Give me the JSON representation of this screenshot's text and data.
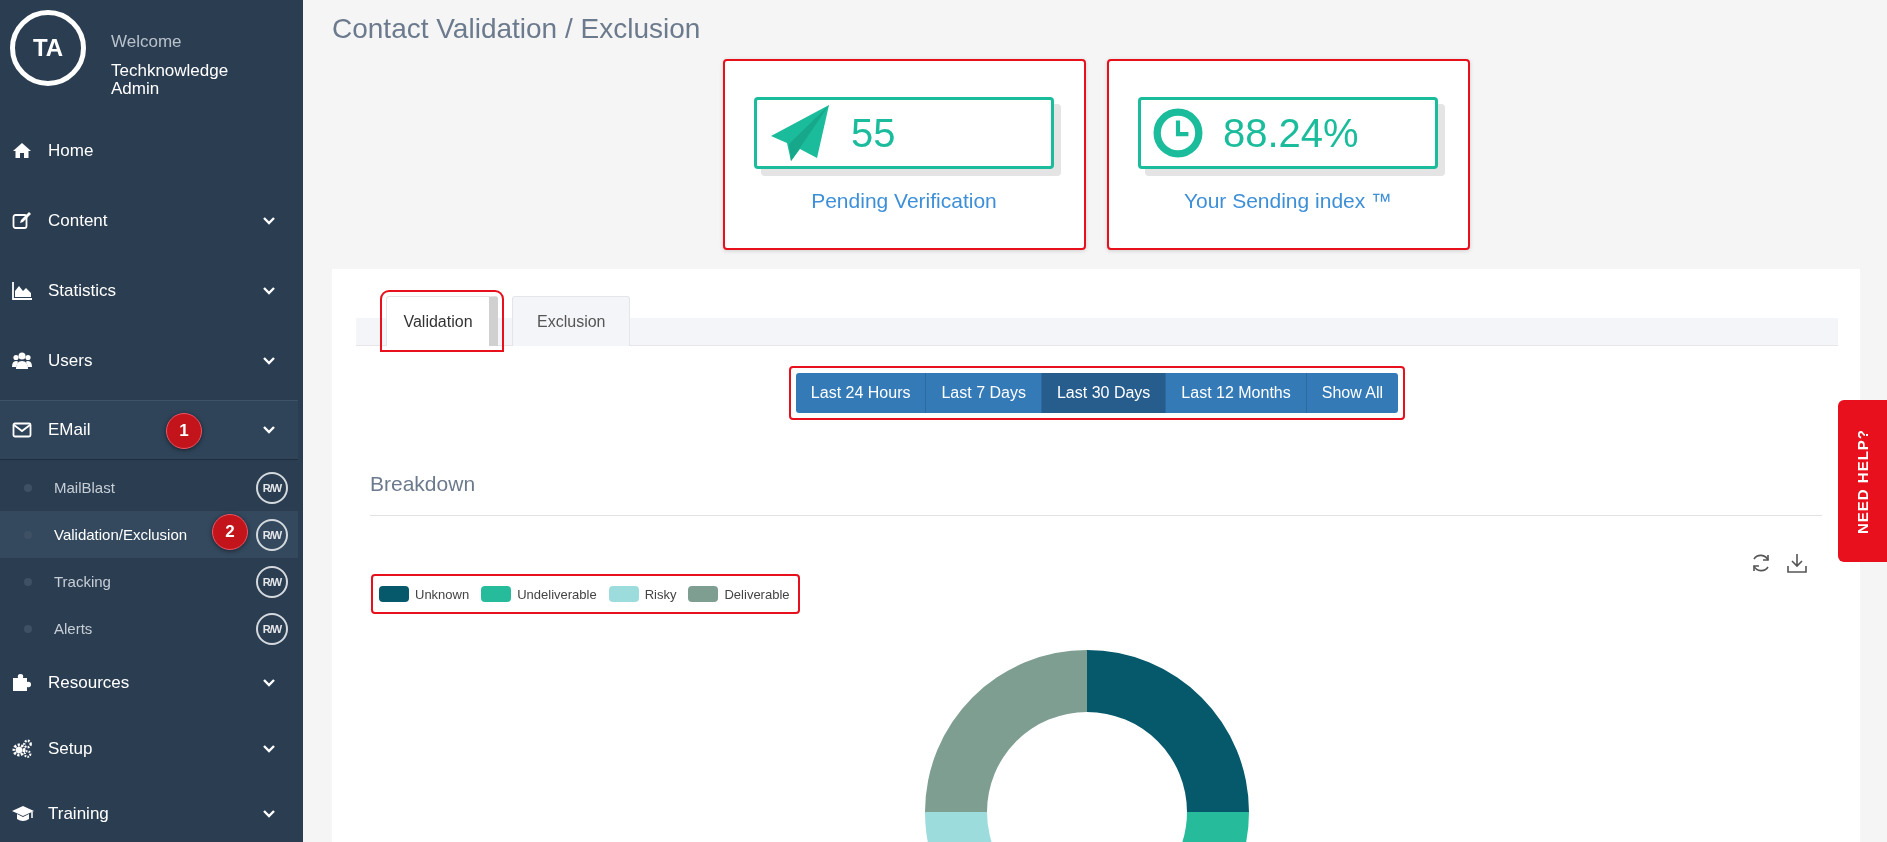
{
  "user": {
    "initials": "TA",
    "greeting": "Welcome",
    "name": "Techknowledge Admin"
  },
  "sidebar": {
    "items": [
      {
        "label": "Home",
        "kind": "link"
      },
      {
        "label": "Content",
        "kind": "group",
        "expanded": false
      },
      {
        "label": "Statistics",
        "kind": "group",
        "expanded": false
      },
      {
        "label": "Users",
        "kind": "group",
        "expanded": false
      },
      {
        "label": "EMail",
        "kind": "group",
        "expanded": true,
        "step": "1",
        "children": [
          {
            "label": "MailBlast",
            "badge": "R/W",
            "selected": false
          },
          {
            "label": "Validation/Exclusion",
            "badge": "R/W",
            "selected": true,
            "step": "2"
          },
          {
            "label": "Tracking",
            "badge": "R/W",
            "selected": false
          },
          {
            "label": "Alerts",
            "badge": "R/W",
            "selected": false
          }
        ]
      },
      {
        "label": "Resources",
        "kind": "group",
        "expanded": false
      },
      {
        "label": "Setup",
        "kind": "group",
        "expanded": false
      },
      {
        "label": "Training",
        "kind": "group",
        "expanded": false
      }
    ]
  },
  "page_title": "Contact Validation / Exclusion",
  "stats": [
    {
      "value": "55",
      "label": "Pending Verification",
      "highlighted": true
    },
    {
      "value": "88.24%",
      "label": "Your Sending index ™",
      "highlighted": true
    }
  ],
  "tabs": [
    {
      "label": "Validation",
      "selected": true,
      "highlighted": true
    },
    {
      "label": "Exclusion",
      "selected": false,
      "highlighted": false
    }
  ],
  "periods": {
    "highlighted": true,
    "buttons": [
      {
        "label": "Last 24 Hours",
        "selected": false
      },
      {
        "label": "Last 7 Days",
        "selected": false
      },
      {
        "label": "Last 30 Days",
        "selected": true
      },
      {
        "label": "Last 12 Months",
        "selected": false
      },
      {
        "label": "Show All",
        "selected": false
      }
    ]
  },
  "breakdown": {
    "title": "Breakdown",
    "legend_highlighted": true,
    "legend": [
      {
        "label": "Unknown",
        "color": "#05596b"
      },
      {
        "label": "Undeliverable",
        "color": "#26bb9b"
      },
      {
        "label": "Risky",
        "color": "#9cdcdc"
      },
      {
        "label": "Deliverable",
        "color": "#7d9e90"
      }
    ]
  },
  "help_tab": "NEED HELP?"
}
